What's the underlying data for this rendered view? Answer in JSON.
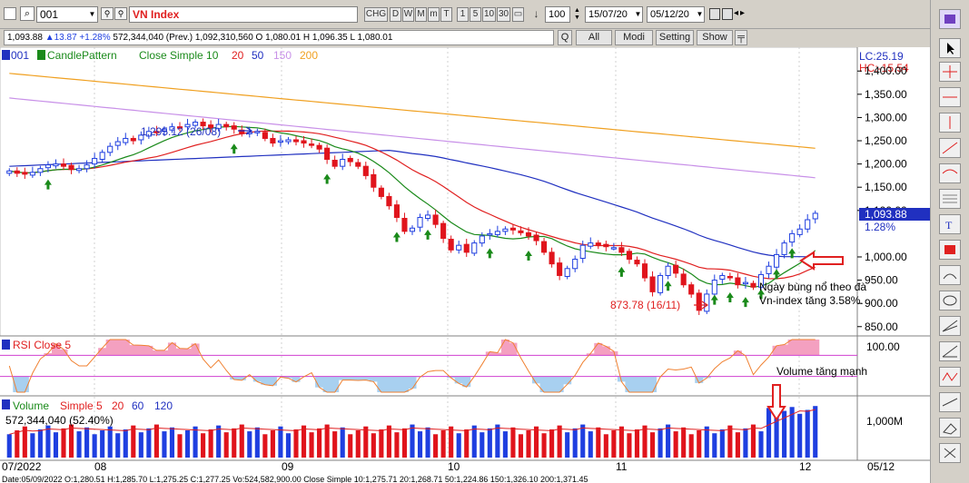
{
  "toolbar": {
    "symbol": "001",
    "index_name": "VN Index",
    "buttons": [
      "CHG",
      "D",
      "W",
      "M",
      "m",
      "T",
      "1",
      "5",
      "10",
      "30"
    ],
    "period_count": "100",
    "date_from": "15/07/20",
    "date_to": "05/12/20"
  },
  "quote_bar": {
    "price": "1,093.88",
    "change": "▲13.87 +1.28%",
    "rest": "572,344,040 (Prev.) 1,092,310,560 O 1,080.01 H 1,096.35 L 1,080.01",
    "q_button": "Q",
    "all_button": "All",
    "modi_button": "Modi",
    "setting_button": "Setting",
    "show_button": "Show"
  },
  "price_panel": {
    "legend": {
      "symbol": "001",
      "pattern": "CandlePattern",
      "ma_label": "Close Simple 10",
      "ma20": "20",
      "ma50": "50",
      "ma150": "150",
      "ma200": "200"
    },
    "lc": "LC:25.19",
    "hc": "HC:-15.54",
    "last_price_tag": "1,093.88",
    "last_pct_tag": "1.28%",
    "y_ticks": [
      "1,400.00",
      "1,350.00",
      "1,300.00",
      "1,250.00",
      "1,200.00",
      "1,150.00",
      "1,100.00",
      "1,000.00",
      "950.00",
      "900.00",
      "850.00"
    ],
    "high_label": "1,295.12 (26/08)",
    "low_label": "873.78 (16/11)",
    "annotation_1": "Ngày bùng nổ theo đà",
    "annotation_2": "Vn-index tăng 3.58%."
  },
  "rsi_panel": {
    "label": "RSI Close 5",
    "y_tick": "100.00",
    "annotation": "Volume tăng mạnh"
  },
  "volume_panel": {
    "label": "Volume",
    "ma_label": "Simple 5",
    "ma20": "20",
    "ma60": "60",
    "ma120": "120",
    "value": "572,344,040 (52.40%)",
    "y_tick": "1,000M"
  },
  "x_axis": {
    "labels": [
      "07/2022",
      "08",
      "09",
      "10",
      "11",
      "12",
      "05/12"
    ]
  },
  "status_line": "Date:05/09/2022 O:1,280.51 H:1,285.70 L:1,275.25 C:1,277.25 Vo:524,582,900.00 Close Simple 10:1,275.71 20:1,268.71 50:1,224.86 150:1,326.10 200:1,371.45",
  "colors": {
    "up": "#1f3fe0",
    "down": "#e0141c",
    "ma10": "#1a8a1a",
    "ma20": "#e02020",
    "ma50": "#2030c0",
    "ma150": "#c890e8",
    "ma200": "#f0a020"
  },
  "chart_data": {
    "type": "candlestick",
    "x_range": [
      "15/07/2022",
      "05/12/2022"
    ],
    "ylim": [
      830,
      1420
    ],
    "closes": [
      1185,
      1180,
      1178,
      1182,
      1190,
      1198,
      1200,
      1195,
      1188,
      1190,
      1198,
      1212,
      1225,
      1238,
      1248,
      1255,
      1250,
      1262,
      1270,
      1268,
      1275,
      1280,
      1278,
      1285,
      1290,
      1282,
      1278,
      1285,
      1280,
      1275,
      1265,
      1268,
      1270,
      1255,
      1245,
      1250,
      1252,
      1248,
      1245,
      1240,
      1232,
      1210,
      1195,
      1210,
      1205,
      1195,
      1175,
      1150,
      1130,
      1110,
      1085,
      1055,
      1062,
      1085,
      1090,
      1070,
      1040,
      1015,
      1025,
      1010,
      1030,
      1045,
      1050,
      1055,
      1060,
      1058,
      1052,
      1045,
      1035,
      1010,
      985,
      960,
      975,
      995,
      1025,
      1030,
      1025,
      1022,
      1020,
      1010,
      995,
      985,
      955,
      925,
      960,
      980,
      965,
      940,
      920,
      885,
      920,
      950,
      960,
      955,
      940,
      945,
      935,
      962,
      980,
      1005,
      1030,
      1050,
      1060,
      1080,
      1093.88
    ],
    "rsi_levels": [
      70,
      30
    ],
    "volume_ylim": [
      0,
      1400
    ]
  }
}
